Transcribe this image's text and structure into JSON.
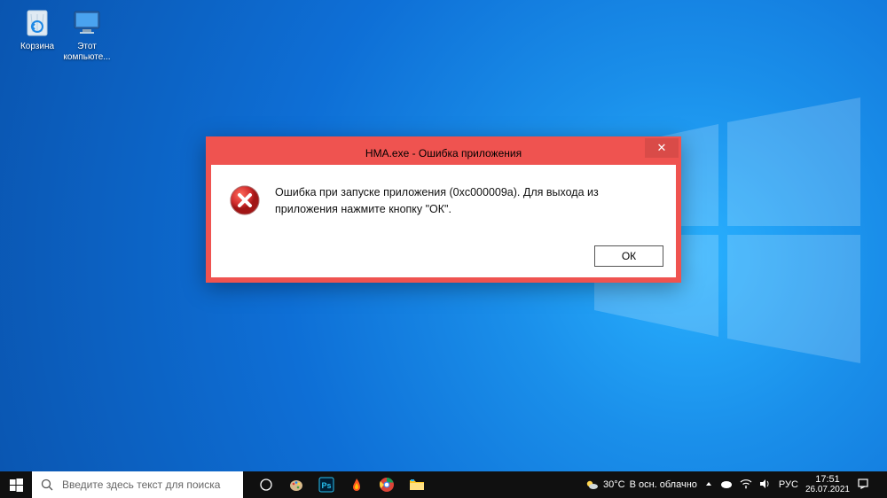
{
  "desktop_icons": {
    "recycle_bin": "Корзина",
    "this_pc": "Этот компьюте..."
  },
  "dialog": {
    "title": "HMA.exe - Ошибка приложения",
    "message": "Ошибка при запуске приложения (0xc000009a). Для выхода из приложения нажмите кнопку \"ОК\".",
    "ok_label": "ОК"
  },
  "taskbar": {
    "search_placeholder": "Введите здесь текст для поиска",
    "weather_temp": "30°C",
    "weather_text": "В осн. облачно",
    "lang": "РУС",
    "time": "17:51",
    "date": "26.07.2021"
  }
}
